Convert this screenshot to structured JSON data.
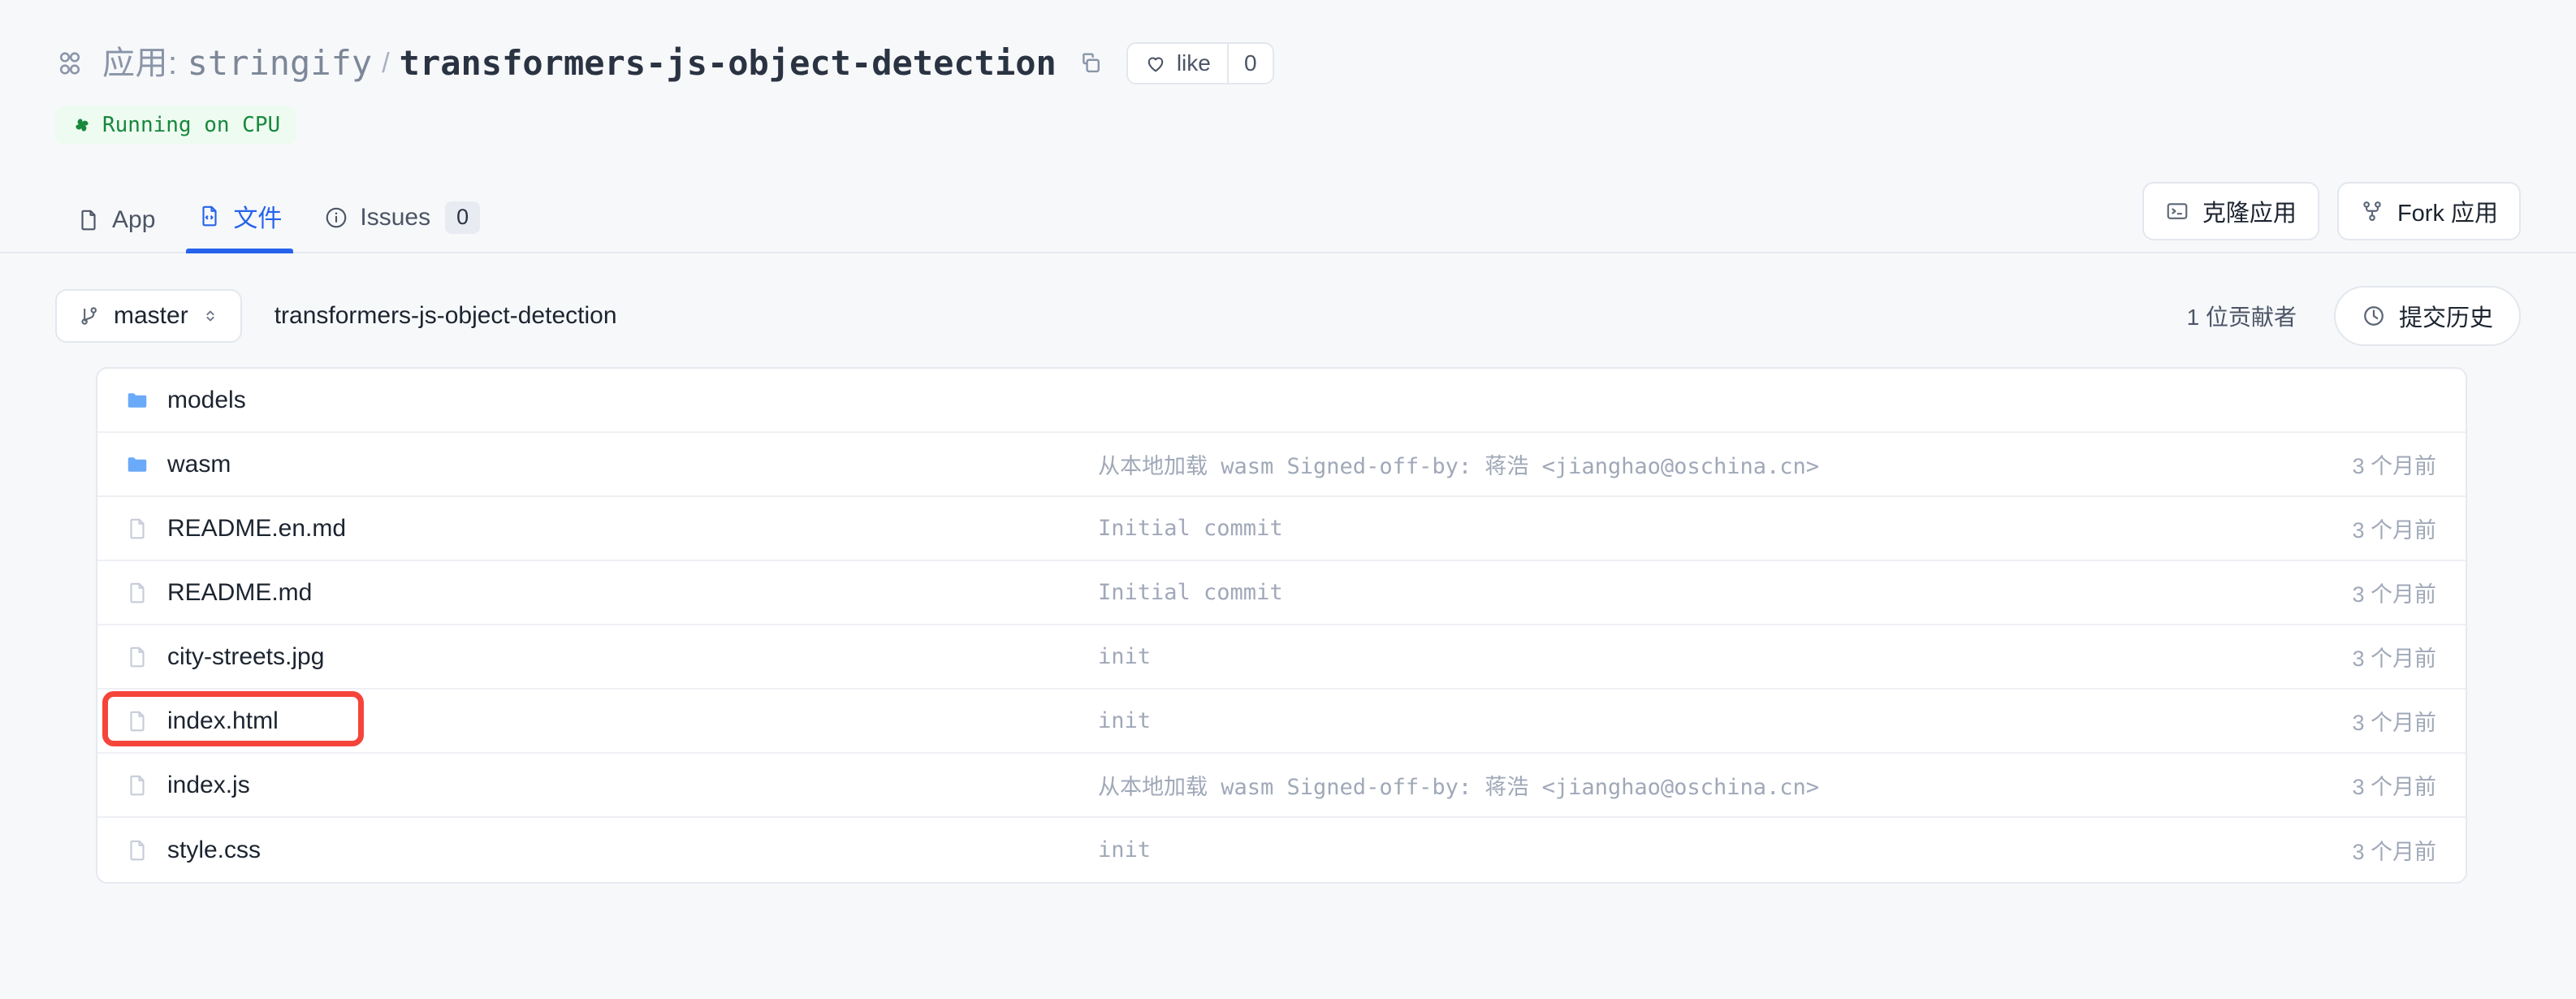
{
  "header": {
    "apps_icon": "apps-grid-icon",
    "title_prefix": "应用:",
    "owner": "stringify",
    "separator": "/",
    "repo_name": "transformers-js-object-detection",
    "copy_icon": "copy-icon",
    "like_label": "like",
    "like_count": "0",
    "like_icon": "heart-icon",
    "status_badge": {
      "icon": "fan-icon",
      "label": "Running on CPU",
      "text_color": "#17883c",
      "bg_color": "#eefbf1"
    }
  },
  "tabs": [
    {
      "id": "app",
      "label": "App",
      "icon": "file-icon",
      "active": false,
      "badge": null
    },
    {
      "id": "files",
      "label": "文件",
      "icon": "code-file-icon",
      "active": true,
      "badge": null
    },
    {
      "id": "issues",
      "label": "Issues",
      "icon": "info-icon",
      "active": false,
      "badge": "0"
    }
  ],
  "header_actions": [
    {
      "id": "clone",
      "label": "克隆应用",
      "icon": "terminal-icon"
    },
    {
      "id": "fork",
      "label": "Fork 应用",
      "icon": "fork-icon"
    }
  ],
  "toolbar": {
    "branch_icon": "branch-icon",
    "branch_name": "master",
    "chevron_icon": "chevron-up-down-icon",
    "breadcrumb_path": "transformers-js-object-detection",
    "contributors": "1 位贡献者",
    "history_icon": "clock-icon",
    "history_label": "提交历史"
  },
  "files": [
    {
      "name": "models",
      "type": "folder",
      "message": "",
      "date": ""
    },
    {
      "name": "wasm",
      "type": "folder",
      "message": "从本地加载 wasm Signed-off-by: 蒋浩 <jianghao@oschina.cn>",
      "date": "3 个月前"
    },
    {
      "name": "README.en.md",
      "type": "file",
      "message": "Initial commit",
      "date": "3 个月前"
    },
    {
      "name": "README.md",
      "type": "file",
      "message": "Initial commit",
      "date": "3 个月前"
    },
    {
      "name": "city-streets.jpg",
      "type": "file",
      "message": "init",
      "date": "3 个月前"
    },
    {
      "name": "index.html",
      "type": "file",
      "message": "init",
      "date": "3 个月前",
      "highlighted": true
    },
    {
      "name": "index.js",
      "type": "file",
      "message": "从本地加载 wasm Signed-off-by: 蒋浩 <jianghao@oschina.cn>",
      "date": "3 个月前"
    },
    {
      "name": "style.css",
      "type": "file",
      "message": "init",
      "date": "3 个月前"
    }
  ],
  "colors": {
    "accent": "#2563eb",
    "folder": "#6aaaf8",
    "highlight": "#f5453a",
    "page_bg": "#f7f8fa",
    "muted": "#a0a8b8"
  }
}
